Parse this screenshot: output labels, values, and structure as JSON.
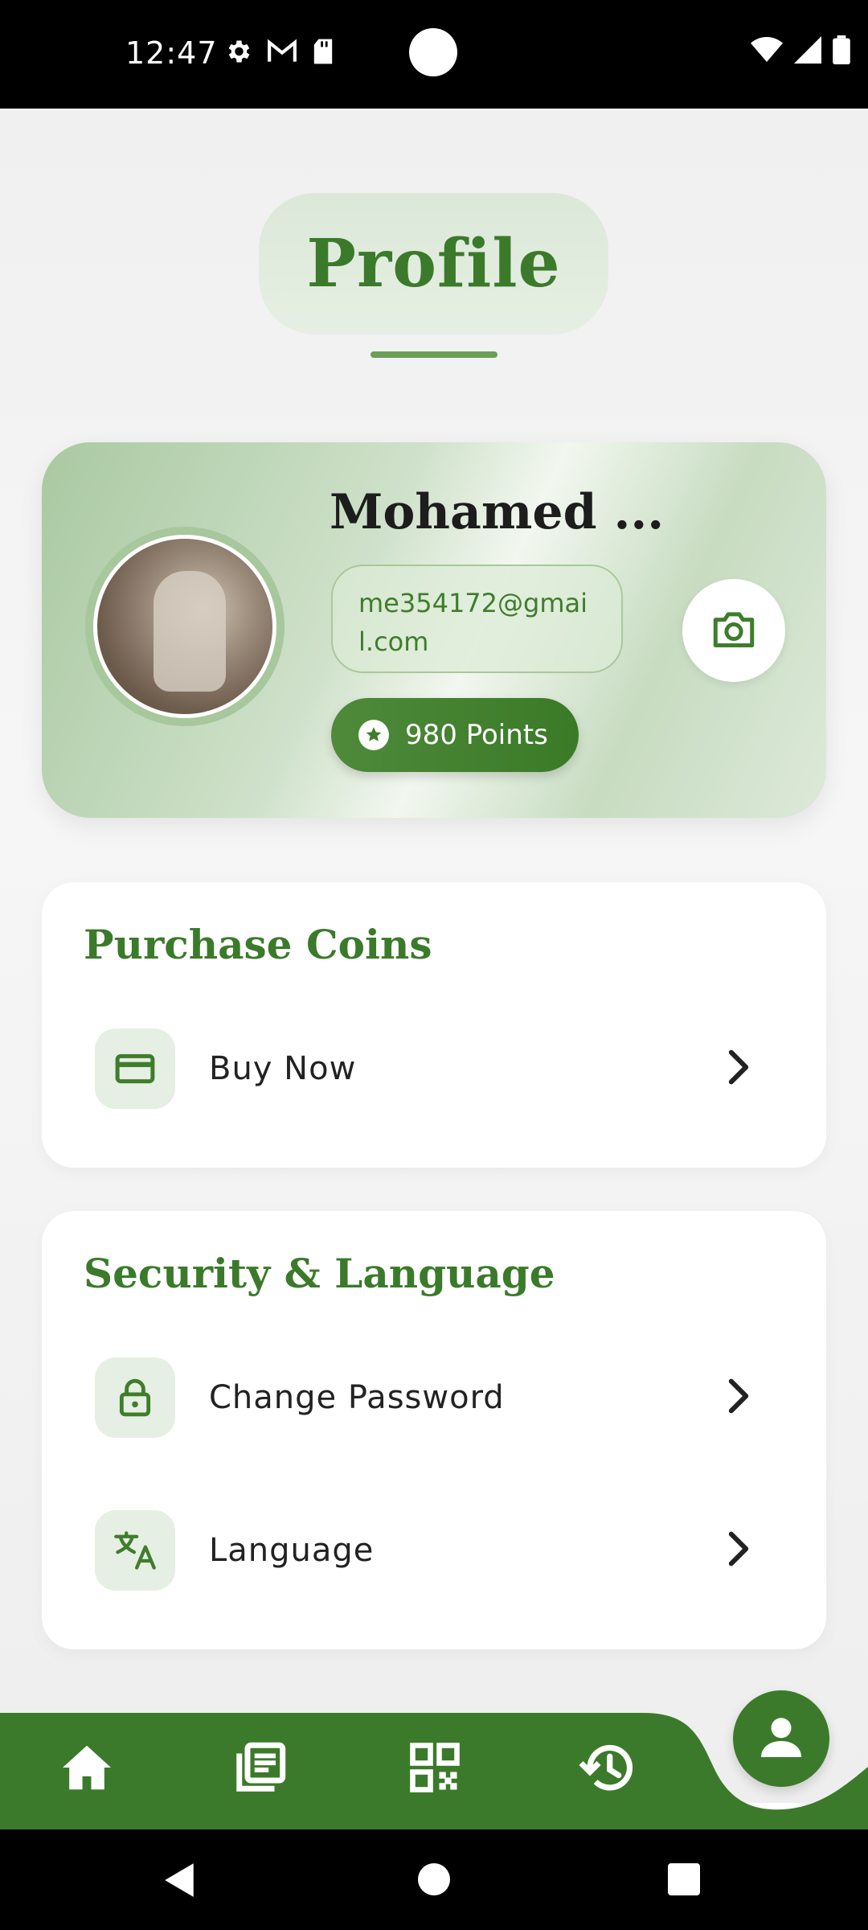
{
  "status_bar": {
    "time": "12:47",
    "left_icons": [
      "gear-icon",
      "gmail-icon",
      "sd-card-icon"
    ],
    "right_icons": [
      "wifi-icon",
      "signal-icon",
      "battery-icon"
    ]
  },
  "header": {
    "title": "Profile"
  },
  "profile": {
    "name": "Mohamed ...",
    "email": "me354172@gmail.com",
    "points_label": "980 Points"
  },
  "sections": {
    "purchase": {
      "title": "Purchase Coins",
      "items": [
        {
          "label": "Buy Now",
          "icon": "credit-card-icon"
        }
      ]
    },
    "security": {
      "title": "Security & Language",
      "items": [
        {
          "label": "Change Password",
          "icon": "lock-icon"
        },
        {
          "label": "Language",
          "icon": "translate-icon"
        }
      ]
    }
  },
  "bottom_nav": {
    "items": [
      "home-icon",
      "news-icon",
      "qr-code-icon",
      "history-icon",
      "person-icon"
    ],
    "active": "person-icon"
  },
  "colors": {
    "brand": "#3b7a2a",
    "accent_light": "#e6efe3"
  }
}
